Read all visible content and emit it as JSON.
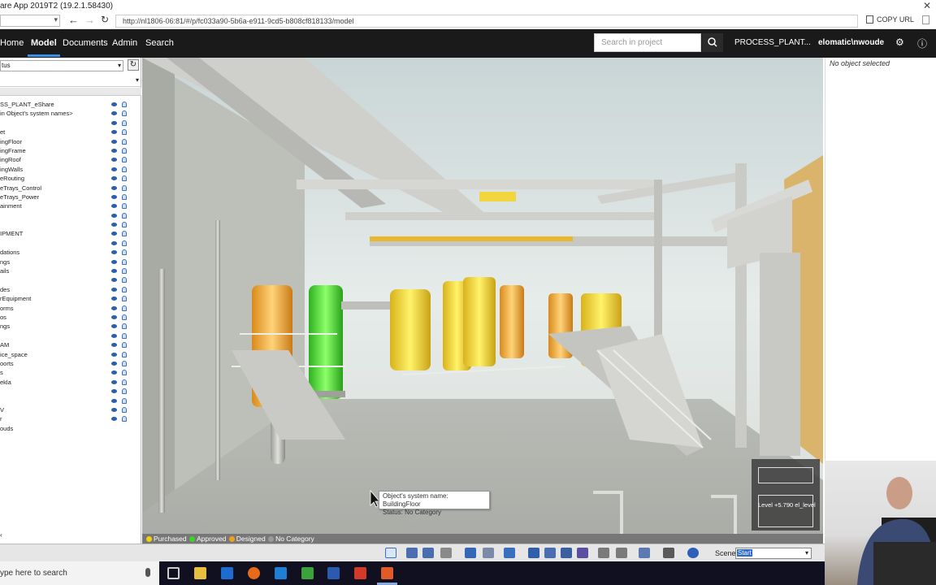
{
  "window": {
    "title": "are App 2019T2 (19.2.1.58430)",
    "close_glyph": "✕"
  },
  "address_bar": {
    "url": "http://nl1806-06:81/#/p/fc033a90-5b6a-e911-9cd5-b808cf818133/model",
    "copy_url_label": "COPY URL"
  },
  "app_nav": {
    "tabs": [
      {
        "label": "Home",
        "active": false
      },
      {
        "label": "Model",
        "active": true
      },
      {
        "label": "Documents",
        "active": false
      },
      {
        "label": "Admin",
        "active": false
      },
      {
        "label": "Search",
        "active": false
      }
    ],
    "search_placeholder": "Search in project",
    "project": "PROCESS_PLANT...",
    "user": "elomatic\\nwoude"
  },
  "left_panel": {
    "filter_value": "tus",
    "tree_rows": [
      {
        "label": "SS_PLANT_eShare",
        "icons": true
      },
      {
        "label": "in Object's system names>",
        "icons": true
      },
      {
        "label": "",
        "icons": true
      },
      {
        "label": "et",
        "icons": true
      },
      {
        "label": "ingFloor",
        "icons": true
      },
      {
        "label": "ingFrame",
        "icons": true
      },
      {
        "label": "ingRoof",
        "icons": true
      },
      {
        "label": "ingWalls",
        "icons": true
      },
      {
        "label": "eRouting",
        "icons": true
      },
      {
        "label": "eTrays_Control",
        "icons": true
      },
      {
        "label": "eTrays_Power",
        "icons": true
      },
      {
        "label": "ainment",
        "icons": true
      },
      {
        "label": "",
        "icons": true
      },
      {
        "label": "",
        "icons": true
      },
      {
        "label": "IPMENT",
        "icons": true
      },
      {
        "label": "",
        "icons": true
      },
      {
        "label": "dations",
        "icons": true
      },
      {
        "label": "ngs",
        "icons": true
      },
      {
        "label": "ails",
        "icons": true
      },
      {
        "label": "",
        "icons": true
      },
      {
        "label": "des",
        "icons": true
      },
      {
        "label": "rEquipment",
        "icons": true
      },
      {
        "label": "orms",
        "icons": true
      },
      {
        "label": "os",
        "icons": true
      },
      {
        "label": "ngs",
        "icons": true
      },
      {
        "label": "",
        "icons": true
      },
      {
        "label": "AM",
        "icons": true
      },
      {
        "label": "ice_space",
        "icons": true
      },
      {
        "label": "oorts",
        "icons": true
      },
      {
        "label": "s",
        "icons": true
      },
      {
        "label": "ekla",
        "icons": true
      },
      {
        "label": "",
        "icons": true
      },
      {
        "label": "",
        "icons": true
      },
      {
        "label": "V",
        "icons": true
      },
      {
        "label": "r",
        "icons": true
      },
      {
        "label": "ouds",
        "icons": false
      }
    ]
  },
  "viewport": {
    "tooltip_line1": "Object's system name: BuildingFloor",
    "tooltip_line2": "Status: No Category",
    "legend": [
      {
        "label": "Purchased",
        "color": "#f2d20a"
      },
      {
        "label": "Approved",
        "color": "#3fcf2f"
      },
      {
        "label": "Designed",
        "color": "#f0a020"
      },
      {
        "label": "No Category",
        "color": "#9a9a9a"
      }
    ],
    "level_label": "Level +5.790 el_level"
  },
  "right_panel": {
    "no_selection": "No object selected"
  },
  "toolbar": {
    "scene_label": "Scene:",
    "scene_value": "Start"
  },
  "taskbar": {
    "search_text": "ype here to search"
  }
}
